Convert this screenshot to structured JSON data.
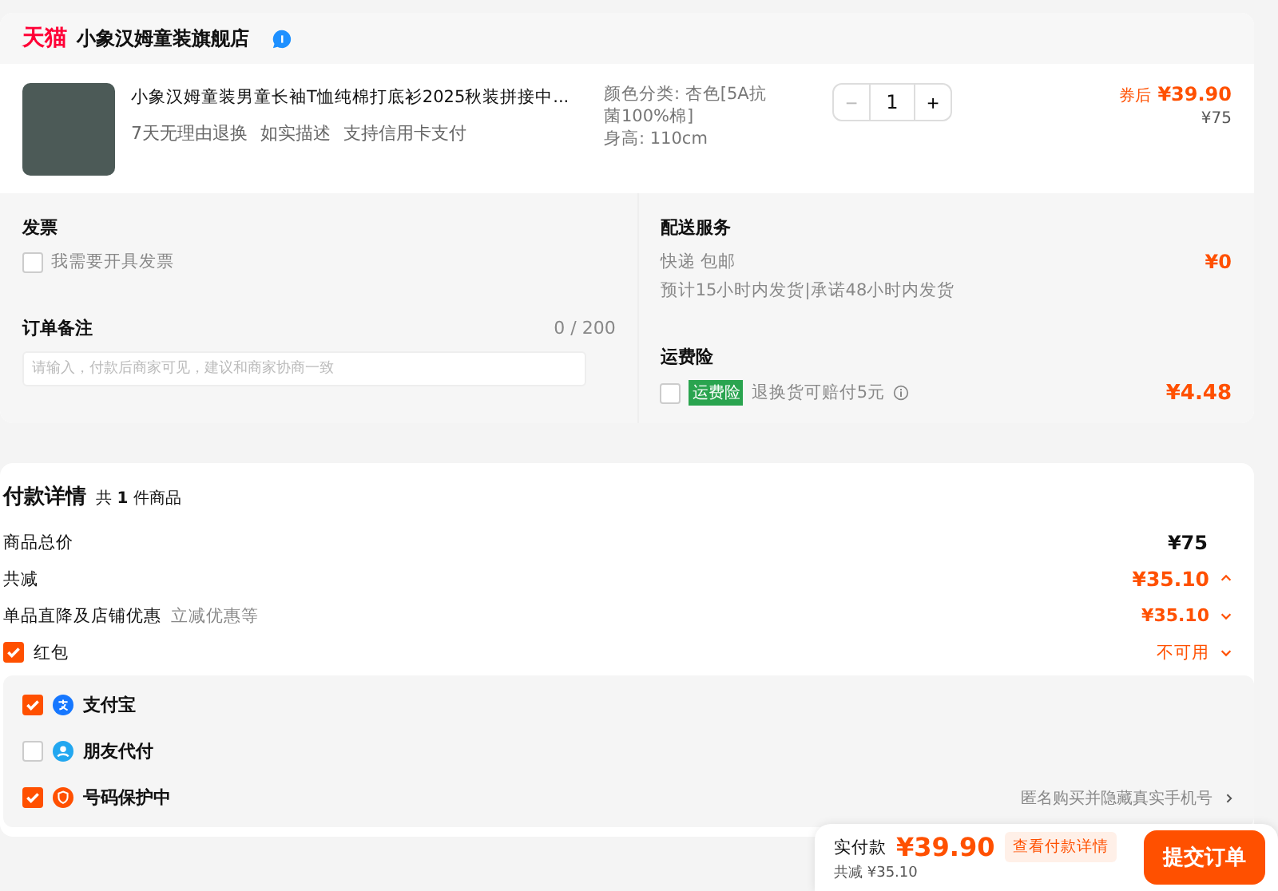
{
  "store": {
    "brand": "天猫",
    "name": "小象汉姆童装旗舰店"
  },
  "product": {
    "title": "小象汉姆童装男童长袖T恤纯棉打底衫2025秋装拼接中...",
    "tags": [
      "7天无理由退换",
      "如实描述",
      "支持信用卡支付"
    ],
    "specs": [
      "颜色分类: 杏色[5A抗菌100%棉]",
      "身高: 110cm"
    ],
    "minus": "−",
    "quantity": "1",
    "plus": "+",
    "coupon_label": "券后",
    "coupon_price": "¥39.90",
    "original_price": "¥75"
  },
  "invoice": {
    "title": "发票",
    "option": "我需要开具发票",
    "checked": false
  },
  "note": {
    "title": "订单备注",
    "count": "0 / 200",
    "placeholder": "请输入，付款后商家可见，建议和商家协商一致"
  },
  "delivery": {
    "title": "配送服务",
    "method": "快递 包邮",
    "eta": "预计15小时内发货|承诺48小时内发货",
    "price": "¥0"
  },
  "insurance": {
    "title": "运费险",
    "checked": false,
    "badge": "运费险",
    "desc": "退换货可赔付5元",
    "price": "¥4.48"
  },
  "payment": {
    "title": "付款详情",
    "count": "共 **1** 件商品",
    "rows": [
      {
        "kind": "total",
        "label": "商品总价",
        "value": "¥75"
      },
      {
        "kind": "discount",
        "label": "共减",
        "value": "¥35.10",
        "expanded": true
      },
      {
        "kind": "sub",
        "label": "单品直降及店铺优惠",
        "note": "立减优惠等",
        "value": "¥35.10",
        "expanded": false
      },
      {
        "kind": "check",
        "label": "红包",
        "checked": true,
        "value": "不可用",
        "expanded": false
      }
    ],
    "options": [
      {
        "kind": "alipay",
        "label": "支付宝",
        "checked": true
      },
      {
        "kind": "friend",
        "label": "朋友代付",
        "checked": false
      },
      {
        "kind": "shield",
        "label": "号码保护中",
        "checked": true,
        "hint": "匿名购买并隐藏真实手机号"
      }
    ]
  },
  "footer": {
    "label": "实付款",
    "price": "¥39.90",
    "detail": "查看付款详情",
    "saved": "共减 ¥35.10",
    "submit": "提交订单"
  }
}
